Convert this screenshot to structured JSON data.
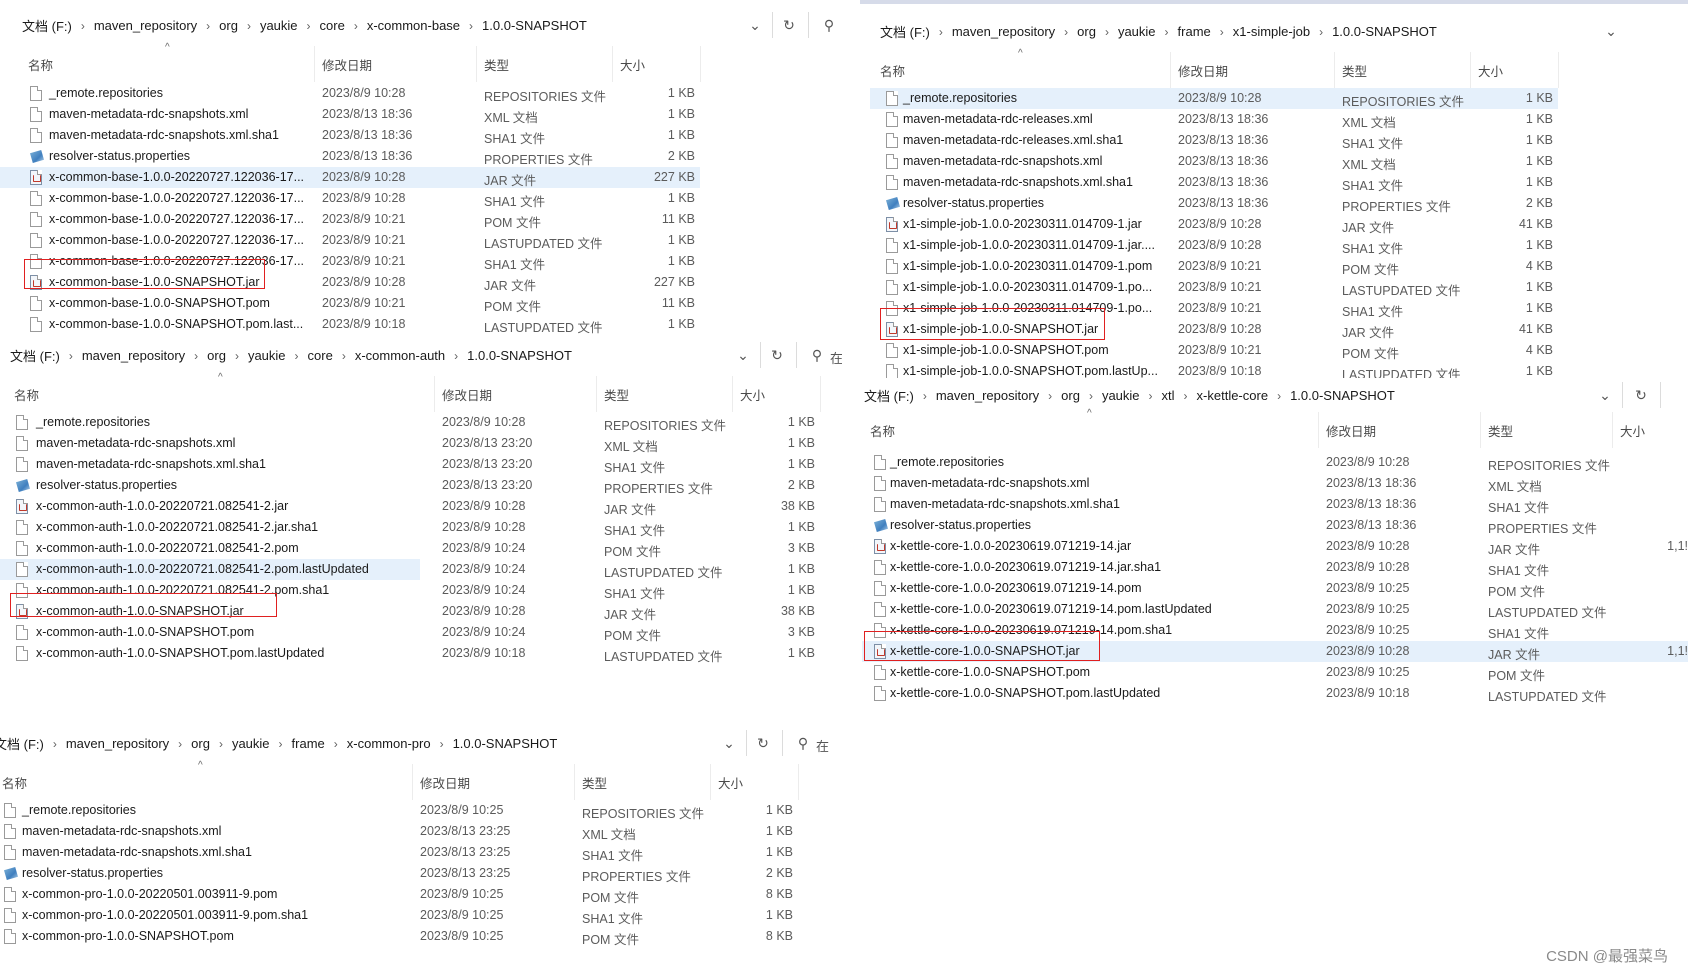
{
  "headers": {
    "name": "名称",
    "date": "修改日期",
    "type": "类型",
    "size": "大小"
  },
  "search_label": "在",
  "windows": [
    {
      "id": "x-common-base",
      "breadcrumb": [
        "文档 (F:)",
        "maven_repository",
        "org",
        "yaukie",
        "core",
        "x-common-base",
        "1.0.0-SNAPSHOT"
      ],
      "files": [
        {
          "name": "_remote.repositories",
          "date": "2023/8/9 10:28",
          "type": "REPOSITORIES 文件",
          "size": "1 KB",
          "icon": "file"
        },
        {
          "name": "maven-metadata-rdc-snapshots.xml",
          "date": "2023/8/13 18:36",
          "type": "XML 文档",
          "size": "1 KB",
          "icon": "file"
        },
        {
          "name": "maven-metadata-rdc-snapshots.xml.sha1",
          "date": "2023/8/13 18:36",
          "type": "SHA1 文件",
          "size": "1 KB",
          "icon": "file"
        },
        {
          "name": "resolver-status.properties",
          "date": "2023/8/13 18:36",
          "type": "PROPERTIES 文件",
          "size": "2 KB",
          "icon": "props"
        },
        {
          "name": "x-common-base-1.0.0-20220727.122036-17...",
          "date": "2023/8/9 10:28",
          "type": "JAR 文件",
          "size": "227 KB",
          "icon": "jar"
        },
        {
          "name": "x-common-base-1.0.0-20220727.122036-17...",
          "date": "2023/8/9 10:28",
          "type": "SHA1 文件",
          "size": "1 KB",
          "icon": "file"
        },
        {
          "name": "x-common-base-1.0.0-20220727.122036-17...",
          "date": "2023/8/9 10:21",
          "type": "POM 文件",
          "size": "11 KB",
          "icon": "file"
        },
        {
          "name": "x-common-base-1.0.0-20220727.122036-17...",
          "date": "2023/8/9 10:21",
          "type": "LASTUPDATED 文件",
          "size": "1 KB",
          "icon": "file"
        },
        {
          "name": "x-common-base-1.0.0-20220727.122036-17...",
          "date": "2023/8/9 10:21",
          "type": "SHA1 文件",
          "size": "1 KB",
          "icon": "file"
        },
        {
          "name": "x-common-base-1.0.0-SNAPSHOT.jar",
          "date": "2023/8/9 10:28",
          "type": "JAR 文件",
          "size": "227 KB",
          "icon": "jar"
        },
        {
          "name": "x-common-base-1.0.0-SNAPSHOT.pom",
          "date": "2023/8/9 10:21",
          "type": "POM 文件",
          "size": "11 KB",
          "icon": "file"
        },
        {
          "name": "x-common-base-1.0.0-SNAPSHOT.pom.last...",
          "date": "2023/8/9 10:18",
          "type": "LASTUPDATED 文件",
          "size": "1 KB",
          "icon": "file"
        }
      ]
    },
    {
      "id": "x-common-auth",
      "breadcrumb": [
        "文档 (F:)",
        "maven_repository",
        "org",
        "yaukie",
        "core",
        "x-common-auth",
        "1.0.0-SNAPSHOT"
      ],
      "files": [
        {
          "name": "_remote.repositories",
          "date": "2023/8/9 10:28",
          "type": "REPOSITORIES 文件",
          "size": "1 KB",
          "icon": "file"
        },
        {
          "name": "maven-metadata-rdc-snapshots.xml",
          "date": "2023/8/13 23:20",
          "type": "XML 文档",
          "size": "1 KB",
          "icon": "file"
        },
        {
          "name": "maven-metadata-rdc-snapshots.xml.sha1",
          "date": "2023/8/13 23:20",
          "type": "SHA1 文件",
          "size": "1 KB",
          "icon": "file"
        },
        {
          "name": "resolver-status.properties",
          "date": "2023/8/13 23:20",
          "type": "PROPERTIES 文件",
          "size": "2 KB",
          "icon": "props"
        },
        {
          "name": "x-common-auth-1.0.0-20220721.082541-2.jar",
          "date": "2023/8/9 10:28",
          "type": "JAR 文件",
          "size": "38 KB",
          "icon": "jar"
        },
        {
          "name": "x-common-auth-1.0.0-20220721.082541-2.jar.sha1",
          "date": "2023/8/9 10:28",
          "type": "SHA1 文件",
          "size": "1 KB",
          "icon": "file"
        },
        {
          "name": "x-common-auth-1.0.0-20220721.082541-2.pom",
          "date": "2023/8/9 10:24",
          "type": "POM 文件",
          "size": "3 KB",
          "icon": "file"
        },
        {
          "name": "x-common-auth-1.0.0-20220721.082541-2.pom.lastUpdated",
          "date": "2023/8/9 10:24",
          "type": "LASTUPDATED 文件",
          "size": "1 KB",
          "icon": "file"
        },
        {
          "name": "x-common-auth-1.0.0-20220721.082541-2.pom.sha1",
          "date": "2023/8/9 10:24",
          "type": "SHA1 文件",
          "size": "1 KB",
          "icon": "file"
        },
        {
          "name": "x-common-auth-1.0.0-SNAPSHOT.jar",
          "date": "2023/8/9 10:28",
          "type": "JAR 文件",
          "size": "38 KB",
          "icon": "jar"
        },
        {
          "name": "x-common-auth-1.0.0-SNAPSHOT.pom",
          "date": "2023/8/9 10:24",
          "type": "POM 文件",
          "size": "3 KB",
          "icon": "file"
        },
        {
          "name": "x-common-auth-1.0.0-SNAPSHOT.pom.lastUpdated",
          "date": "2023/8/9 10:18",
          "type": "LASTUPDATED 文件",
          "size": "1 KB",
          "icon": "file"
        }
      ]
    },
    {
      "id": "x-common-pro",
      "breadcrumb": [
        "文档 (F:)",
        "maven_repository",
        "org",
        "yaukie",
        "frame",
        "x-common-pro",
        "1.0.0-SNAPSHOT"
      ],
      "files": [
        {
          "name": "_remote.repositories",
          "date": "2023/8/9 10:25",
          "type": "REPOSITORIES 文件",
          "size": "1 KB",
          "icon": "file"
        },
        {
          "name": "maven-metadata-rdc-snapshots.xml",
          "date": "2023/8/13 23:25",
          "type": "XML 文档",
          "size": "1 KB",
          "icon": "file"
        },
        {
          "name": "maven-metadata-rdc-snapshots.xml.sha1",
          "date": "2023/8/13 23:25",
          "type": "SHA1 文件",
          "size": "1 KB",
          "icon": "file"
        },
        {
          "name": "resolver-status.properties",
          "date": "2023/8/13 23:25",
          "type": "PROPERTIES 文件",
          "size": "2 KB",
          "icon": "props"
        },
        {
          "name": "x-common-pro-1.0.0-20220501.003911-9.pom",
          "date": "2023/8/9 10:25",
          "type": "POM 文件",
          "size": "8 KB",
          "icon": "file"
        },
        {
          "name": "x-common-pro-1.0.0-20220501.003911-9.pom.sha1",
          "date": "2023/8/9 10:25",
          "type": "SHA1 文件",
          "size": "1 KB",
          "icon": "file"
        },
        {
          "name": "x-common-pro-1.0.0-SNAPSHOT.pom",
          "date": "2023/8/9 10:25",
          "type": "POM 文件",
          "size": "8 KB",
          "icon": "file"
        }
      ]
    },
    {
      "id": "x1-simple-job",
      "breadcrumb": [
        "文档 (F:)",
        "maven_repository",
        "org",
        "yaukie",
        "frame",
        "x1-simple-job",
        "1.0.0-SNAPSHOT"
      ],
      "files": [
        {
          "name": "_remote.repositories",
          "date": "2023/8/9 10:28",
          "type": "REPOSITORIES 文件",
          "size": "1 KB",
          "icon": "file"
        },
        {
          "name": "maven-metadata-rdc-releases.xml",
          "date": "2023/8/13 18:36",
          "type": "XML 文档",
          "size": "1 KB",
          "icon": "file"
        },
        {
          "name": "maven-metadata-rdc-releases.xml.sha1",
          "date": "2023/8/13 18:36",
          "type": "SHA1 文件",
          "size": "1 KB",
          "icon": "file"
        },
        {
          "name": "maven-metadata-rdc-snapshots.xml",
          "date": "2023/8/13 18:36",
          "type": "XML 文档",
          "size": "1 KB",
          "icon": "file"
        },
        {
          "name": "maven-metadata-rdc-snapshots.xml.sha1",
          "date": "2023/8/13 18:36",
          "type": "SHA1 文件",
          "size": "1 KB",
          "icon": "file"
        },
        {
          "name": "resolver-status.properties",
          "date": "2023/8/13 18:36",
          "type": "PROPERTIES 文件",
          "size": "2 KB",
          "icon": "props"
        },
        {
          "name": "x1-simple-job-1.0.0-20230311.014709-1.jar",
          "date": "2023/8/9 10:28",
          "type": "JAR 文件",
          "size": "41 KB",
          "icon": "jar"
        },
        {
          "name": "x1-simple-job-1.0.0-20230311.014709-1.jar....",
          "date": "2023/8/9 10:28",
          "type": "SHA1 文件",
          "size": "1 KB",
          "icon": "file"
        },
        {
          "name": "x1-simple-job-1.0.0-20230311.014709-1.pom",
          "date": "2023/8/9 10:21",
          "type": "POM 文件",
          "size": "4 KB",
          "icon": "file"
        },
        {
          "name": "x1-simple-job-1.0.0-20230311.014709-1.po...",
          "date": "2023/8/9 10:21",
          "type": "LASTUPDATED 文件",
          "size": "1 KB",
          "icon": "file"
        },
        {
          "name": "x1-simple-job-1.0.0-20230311.014709-1.po...",
          "date": "2023/8/9 10:21",
          "type": "SHA1 文件",
          "size": "1 KB",
          "icon": "file"
        },
        {
          "name": "x1-simple-job-1.0.0-SNAPSHOT.jar",
          "date": "2023/8/9 10:28",
          "type": "JAR 文件",
          "size": "41 KB",
          "icon": "jar"
        },
        {
          "name": "x1-simple-job-1.0.0-SNAPSHOT.pom",
          "date": "2023/8/9 10:21",
          "type": "POM 文件",
          "size": "4 KB",
          "icon": "file"
        },
        {
          "name": "x1-simple-job-1.0.0-SNAPSHOT.pom.lastUp...",
          "date": "2023/8/9 10:18",
          "type": "LASTUPDATED 文件",
          "size": "1 KB",
          "icon": "file"
        }
      ]
    },
    {
      "id": "x-kettle-core",
      "breadcrumb": [
        "文档 (F:)",
        "maven_repository",
        "org",
        "yaukie",
        "xtl",
        "x-kettle-core",
        "1.0.0-SNAPSHOT"
      ],
      "files": [
        {
          "name": "_remote.repositories",
          "date": "2023/8/9 10:28",
          "type": "REPOSITORIES 文件",
          "size": "",
          "icon": "file"
        },
        {
          "name": "maven-metadata-rdc-snapshots.xml",
          "date": "2023/8/13 18:36",
          "type": "XML 文档",
          "size": "",
          "icon": "file"
        },
        {
          "name": "maven-metadata-rdc-snapshots.xml.sha1",
          "date": "2023/8/13 18:36",
          "type": "SHA1 文件",
          "size": "",
          "icon": "file"
        },
        {
          "name": "resolver-status.properties",
          "date": "2023/8/13 18:36",
          "type": "PROPERTIES 文件",
          "size": "",
          "icon": "props"
        },
        {
          "name": "x-kettle-core-1.0.0-20230619.071219-14.jar",
          "date": "2023/8/9 10:28",
          "type": "JAR 文件",
          "size": "1,1!",
          "icon": "jar"
        },
        {
          "name": "x-kettle-core-1.0.0-20230619.071219-14.jar.sha1",
          "date": "2023/8/9 10:28",
          "type": "SHA1 文件",
          "size": "",
          "icon": "file"
        },
        {
          "name": "x-kettle-core-1.0.0-20230619.071219-14.pom",
          "date": "2023/8/9 10:25",
          "type": "POM 文件",
          "size": "",
          "icon": "file"
        },
        {
          "name": "x-kettle-core-1.0.0-20230619.071219-14.pom.lastUpdated",
          "date": "2023/8/9 10:25",
          "type": "LASTUPDATED 文件",
          "size": "",
          "icon": "file"
        },
        {
          "name": "x-kettle-core-1.0.0-20230619.071219-14.pom.sha1",
          "date": "2023/8/9 10:25",
          "type": "SHA1 文件",
          "size": "",
          "icon": "file"
        },
        {
          "name": "x-kettle-core-1.0.0-SNAPSHOT.jar",
          "date": "2023/8/9 10:28",
          "type": "JAR 文件",
          "size": "1,1!",
          "icon": "jar"
        },
        {
          "name": "x-kettle-core-1.0.0-SNAPSHOT.pom",
          "date": "2023/8/9 10:25",
          "type": "POM 文件",
          "size": "",
          "icon": "file"
        },
        {
          "name": "x-kettle-core-1.0.0-SNAPSHOT.pom.lastUpdated",
          "date": "2023/8/9 10:18",
          "type": "LASTUPDATED 文件",
          "size": "",
          "icon": "file"
        }
      ]
    }
  ],
  "watermark": "CSDN @最强菜鸟"
}
